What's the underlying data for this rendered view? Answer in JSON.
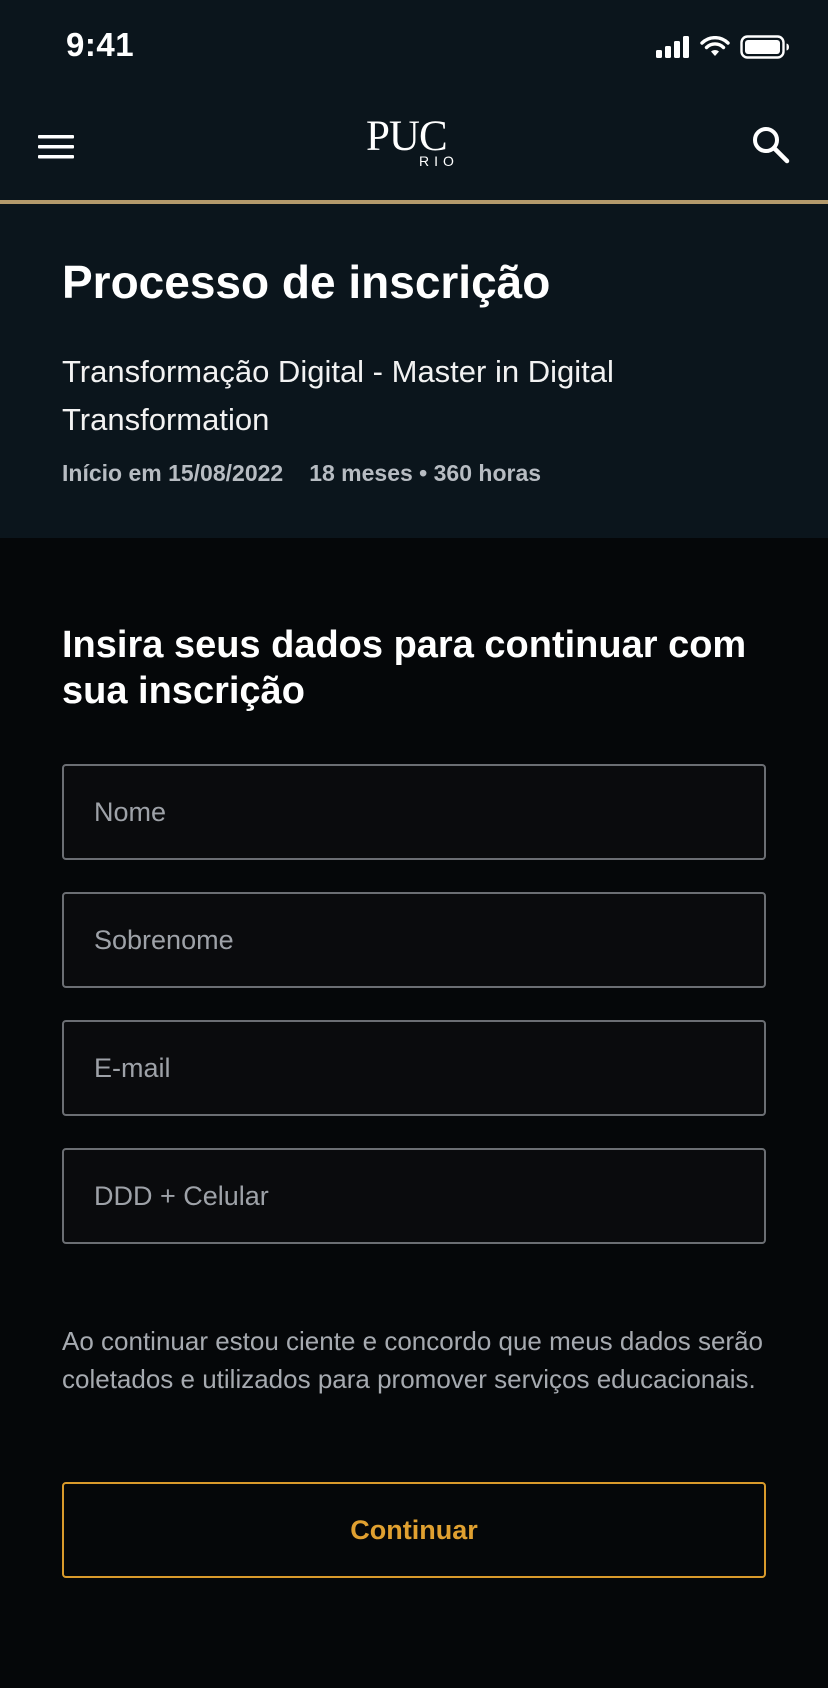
{
  "status_bar": {
    "time": "9:41"
  },
  "header": {
    "logo_main": "PUC",
    "logo_sub": "RIO",
    "menu_icon": "hamburger-menu-icon",
    "search_icon": "search-icon"
  },
  "hero": {
    "title": "Processo de inscrição",
    "course_name": "Transformação Digital - Master in Digital Transformation",
    "start_date": "Início em 15/08/2022",
    "duration": "18 meses • 360 horas"
  },
  "form": {
    "heading": "Insira seus dados para continuar com sua inscrição",
    "fields": {
      "first_name": {
        "placeholder": "Nome",
        "value": ""
      },
      "last_name": {
        "placeholder": "Sobrenome",
        "value": ""
      },
      "email": {
        "placeholder": "E-mail",
        "value": ""
      },
      "phone": {
        "placeholder": "DDD + Celular",
        "value": ""
      }
    },
    "consent": "Ao continuar estou ciente e concordo que meus dados serão coletados e utilizados para promover serviços educacionais.",
    "continue_label": "Continuar"
  },
  "colors": {
    "header_bg": "#0b151c",
    "page_bg": "#050709",
    "accent_gold": "#b49a6c",
    "button_orange": "#d99a2b"
  }
}
